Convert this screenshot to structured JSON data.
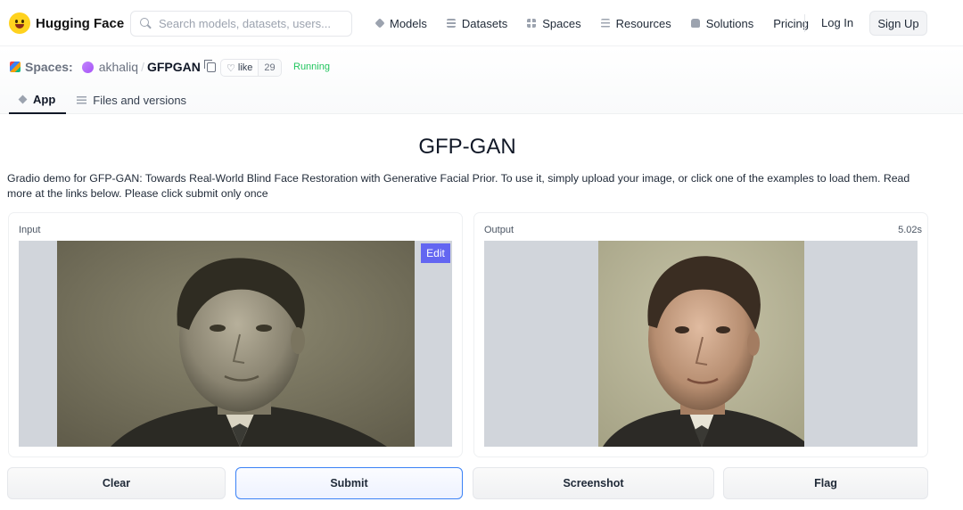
{
  "nav": {
    "brand": "Hugging Face",
    "search_placeholder": "Search models, datasets, users...",
    "links": [
      {
        "label": "Models",
        "icon": "cube-icon"
      },
      {
        "label": "Datasets",
        "icon": "datasets-icon"
      },
      {
        "label": "Spaces",
        "icon": "spaces-icon"
      },
      {
        "label": "Resources",
        "icon": "menu-icon"
      },
      {
        "label": "Solutions",
        "icon": "briefcase-icon"
      },
      {
        "label": "Pricing",
        "icon": ""
      }
    ],
    "login": "Log In",
    "signup": "Sign Up"
  },
  "space": {
    "section": "Spaces:",
    "user": "akhaliq",
    "separator": "/",
    "repo": "GFPGAN",
    "like_label": "like",
    "like_count": "29",
    "status": "Running",
    "tabs": [
      {
        "label": "App",
        "active": true
      },
      {
        "label": "Files and versions",
        "active": false
      }
    ]
  },
  "app": {
    "title": "GFP-GAN",
    "description": "Gradio demo for GFP-GAN: Towards Real-World Blind Face Restoration with Generative Facial Prior. To use it, simply upload your image, or click one of the examples to load them. Read more at the links below. Please click submit only once",
    "input_label": "Input",
    "edit_label": "Edit",
    "output_label": "Output",
    "output_time": "5.02s",
    "buttons": {
      "clear": "Clear",
      "submit": "Submit",
      "screenshot": "Screenshot",
      "flag": "Flag"
    }
  },
  "colors": {
    "accent": "#6366f1",
    "status": "#22c55e",
    "primary_border": "#3b82f6"
  }
}
